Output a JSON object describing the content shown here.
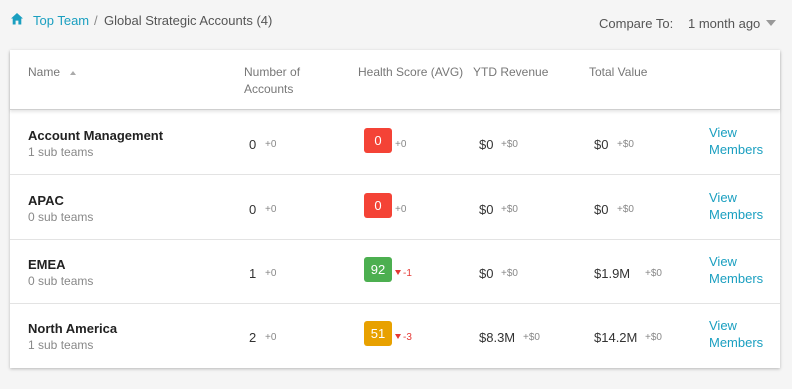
{
  "breadcrumb": {
    "home_link": "Top Team",
    "separator": "/",
    "current": "Global Strategic Accounts (4)"
  },
  "compare": {
    "label": "Compare To:",
    "selected": "1 month ago"
  },
  "table": {
    "headers": {
      "name": "Name",
      "accounts": "Number of Accounts",
      "health": "Health Score (AVG)",
      "ytd": "YTD Revenue",
      "total": "Total Value"
    },
    "rows": [
      {
        "name": "Account Management",
        "sub": "1 sub teams",
        "accounts": "0",
        "accounts_delta": "+0",
        "health": "0",
        "health_delta": "+0",
        "health_trend": "neutral",
        "health_color": "#f44336",
        "ytd": "$0",
        "ytd_delta": "+$0",
        "total": "$0",
        "total_delta": "+$0",
        "link": "View Members"
      },
      {
        "name": "APAC",
        "sub": "0 sub teams",
        "accounts": "0",
        "accounts_delta": "+0",
        "health": "0",
        "health_delta": "+0",
        "health_trend": "neutral",
        "health_color": "#f44336",
        "ytd": "$0",
        "ytd_delta": "+$0",
        "total": "$0",
        "total_delta": "+$0",
        "link": "View Members"
      },
      {
        "name": "EMEA",
        "sub": "0 sub teams",
        "accounts": "1",
        "accounts_delta": "+0",
        "health": "92",
        "health_delta": "-1",
        "health_trend": "down",
        "health_color": "#4caf50",
        "ytd": "$0",
        "ytd_delta": "+$0",
        "total": "$1.9M",
        "total_delta": "+$0",
        "link": "View Members"
      },
      {
        "name": "North America",
        "sub": "1 sub teams",
        "accounts": "2",
        "accounts_delta": "+0",
        "health": "51",
        "health_delta": "-3",
        "health_trend": "down",
        "health_color": "#e8a100",
        "ytd": "$8.3M",
        "ytd_delta": "+$0",
        "total": "$14.2M",
        "total_delta": "+$0",
        "link": "View Members"
      }
    ]
  },
  "colors": {
    "accent": "#1a9fc0",
    "negative": "#e53935"
  },
  "icons": {
    "home": "home-icon",
    "sort": "sort-asc-icon",
    "dropdown": "chevron-down-icon",
    "trend_down": "triangle-down-icon"
  }
}
